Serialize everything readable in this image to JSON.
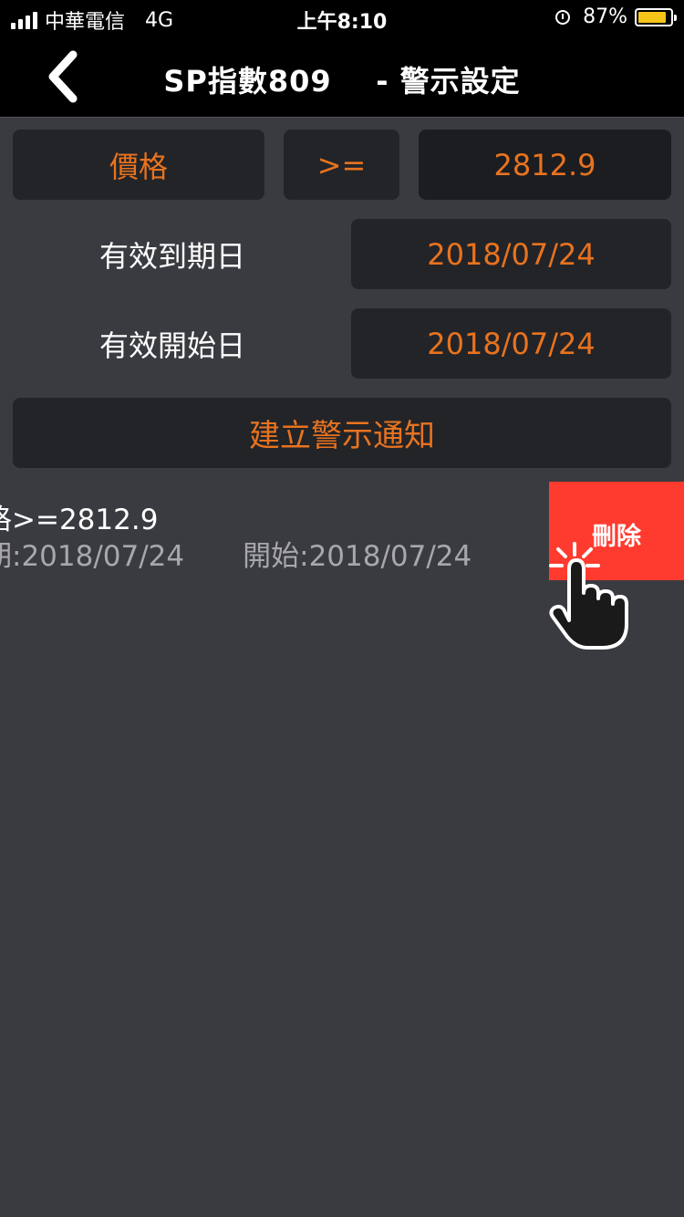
{
  "status_bar": {
    "carrier": "中華電信",
    "network": "4G",
    "time": "上午8:10",
    "battery": "87%",
    "battery_level": 0.87,
    "icons": [
      "signal-icon",
      "alarm-icon",
      "battery-icon"
    ]
  },
  "nav": {
    "back_icon": "chevron-left-icon",
    "title": "SP指數809    - 警示設定"
  },
  "form": {
    "field_label": "價格",
    "operator": ">=",
    "value": "2812.9",
    "expiry_label": "有效到期日",
    "expiry_value": "2018/07/24",
    "start_label": "有效開始日",
    "start_value": "2018/07/24",
    "create_button": "建立警示通知"
  },
  "alerts": [
    {
      "condition": "格>=2812.9",
      "expiry": "期:2018/07/24",
      "start": "開始:2018/07/24",
      "delete_label": "刪除"
    }
  ],
  "colors": {
    "background": "#3a3b40",
    "bar": "#000000",
    "field": "#232428",
    "accent": "#e8731f",
    "delete": "#ff3b30",
    "battery": "#f5c518"
  }
}
